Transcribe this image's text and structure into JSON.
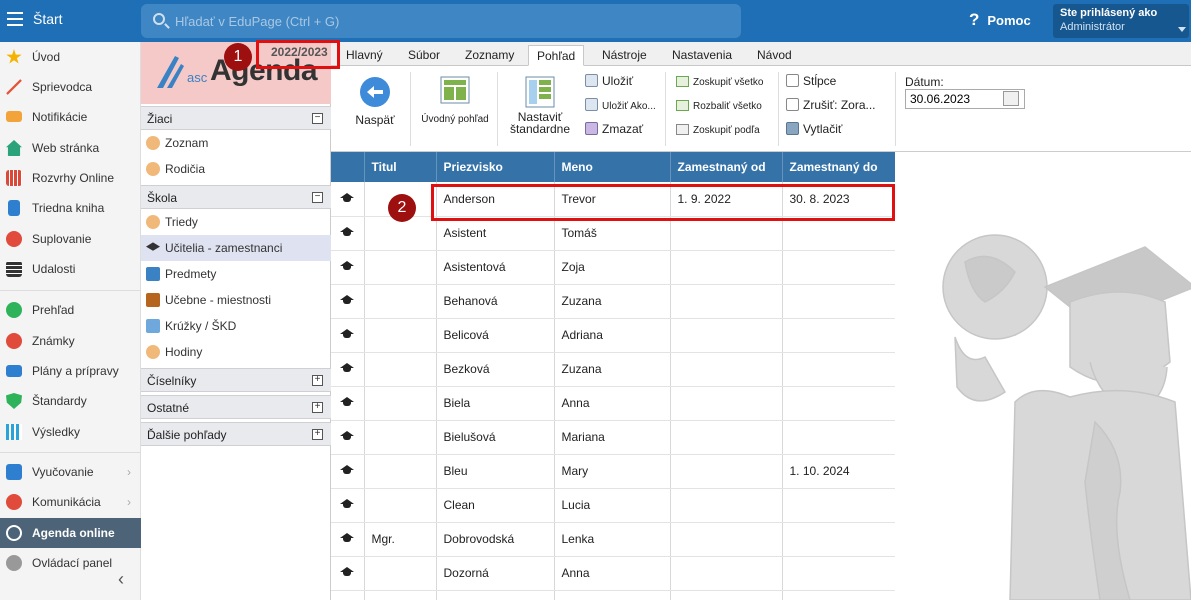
{
  "topbar": {
    "start_label": "Štart",
    "search_placeholder": "Hľadať v EduPage (Ctrl + G)",
    "help_label": "Pomoc",
    "user_line1": "Ste prihlásený ako",
    "user_line2": "Administrátor"
  },
  "leftnav": {
    "items": [
      {
        "label": "Úvod",
        "icon": "star-icon",
        "color": "#f5b301"
      },
      {
        "label": "Sprievodca",
        "icon": "wand-icon",
        "color": "#e2553b"
      },
      {
        "label": "Notifikácie",
        "icon": "envelope-icon",
        "color": "#f2a33a"
      },
      {
        "label": "Web stránka",
        "icon": "home-icon",
        "color": "#2aa37a"
      },
      {
        "label": "Rozvrhy Online",
        "icon": "grid-icon",
        "color": "#d94a3b"
      },
      {
        "label": "Triedna kniha",
        "icon": "book-icon",
        "color": "#2f7fd0"
      },
      {
        "label": "Suplovanie",
        "icon": "person-icon",
        "color": "#e04b3b"
      },
      {
        "label": "Udalosti",
        "icon": "calendar-icon",
        "color": "#333333"
      },
      {
        "label": "Prehľad",
        "icon": "check-icon",
        "color": "#2fb35a"
      },
      {
        "label": "Známky",
        "icon": "grade-icon",
        "color": "#e04b3b"
      },
      {
        "label": "Plány a prípravy",
        "icon": "briefcase-icon",
        "color": "#2f7fd0"
      },
      {
        "label": "Štandardy",
        "icon": "shield-icon",
        "color": "#2fb35a"
      },
      {
        "label": "Výsledky",
        "icon": "bar-chart-icon",
        "color": "#2aa3d9"
      },
      {
        "label": "Vyučovanie",
        "icon": "teaching-icon",
        "color": "#2f7fd0"
      },
      {
        "label": "Komunikácia",
        "icon": "chat-icon",
        "color": "#e04b3b"
      },
      {
        "label": "Agenda online",
        "icon": "agenda-icon",
        "color": "#ffffff"
      },
      {
        "label": "Ovládací panel",
        "icon": "gear-icon",
        "color": "#999999"
      }
    ]
  },
  "agenda": {
    "logo_prefix": "asc",
    "logo_text": "Agenda",
    "sections": {
      "ziaci": "Žiaci",
      "skola": "Škola",
      "ciselniky": "Číselníky",
      "ostatne": "Ostatné",
      "dalsie": "Ďalšie pohľady"
    },
    "ziaci_items": [
      "Zoznam",
      "Rodičia"
    ],
    "skola_items": [
      "Triedy",
      "Učitelia - zamestnanci",
      "Predmety",
      "Učebne - miestnosti",
      "Krúžky / ŠKD",
      "Hodiny"
    ],
    "expanded_symbol": "−",
    "collapsed_symbol": "+"
  },
  "ribbon": {
    "year": "2022/2023",
    "tabs": [
      "Hlavný",
      "Súbor",
      "Zoznamy",
      "Pohľad",
      "Nástroje",
      "Nastavenia",
      "Návod"
    ],
    "active_tab": "Pohľad",
    "back_label": "Naspäť",
    "intro_view_label": "Úvodný pohľad",
    "set_standard_label_1": "Nastaviť",
    "set_standard_label_2": "štandardne",
    "save_label": "Uložiť",
    "save_as_label": "Uložiť Ako...",
    "delete_label": "Zmazať",
    "group_all_label": "Zoskupiť všetko",
    "expand_all_label": "Rozbaliť všetko",
    "group_by_label": "Zoskupiť podľa",
    "columns_label": "Stĺpce",
    "cancel_sort_label": "Zrušiť: Zora...",
    "print_label": "Vytlačiť",
    "date_label": "Dátum:",
    "date_value": "30.06.2023"
  },
  "table": {
    "headers": [
      "",
      "Titul",
      "Priezvisko",
      "Meno",
      "Zamestnaný od",
      "Zamestnaný do"
    ],
    "rows": [
      {
        "titul": "",
        "priezvisko": "Anderson",
        "meno": "Trevor",
        "od": "1. 9. 2022",
        "do": "30. 8. 2023"
      },
      {
        "titul": "",
        "priezvisko": "Asistent",
        "meno": "Tomáš",
        "od": "",
        "do": ""
      },
      {
        "titul": "",
        "priezvisko": "Asistentová",
        "meno": "Zoja",
        "od": "",
        "do": ""
      },
      {
        "titul": "",
        "priezvisko": "Behanová",
        "meno": "Zuzana",
        "od": "",
        "do": ""
      },
      {
        "titul": "",
        "priezvisko": "Belicová",
        "meno": "Adriana",
        "od": "",
        "do": ""
      },
      {
        "titul": "",
        "priezvisko": "Bezková",
        "meno": "Zuzana",
        "od": "",
        "do": ""
      },
      {
        "titul": "",
        "priezvisko": "Biela",
        "meno": "Anna",
        "od": "",
        "do": ""
      },
      {
        "titul": "",
        "priezvisko": "Bielušová",
        "meno": "Mariana",
        "od": "",
        "do": ""
      },
      {
        "titul": "",
        "priezvisko": "Bleu",
        "meno": "Mary",
        "od": "",
        "do": "1. 10. 2024"
      },
      {
        "titul": "",
        "priezvisko": "Clean",
        "meno": "Lucia",
        "od": "",
        "do": ""
      },
      {
        "titul": "Mgr.",
        "priezvisko": "Dobrovodská",
        "meno": "Lenka",
        "od": "",
        "do": ""
      },
      {
        "titul": "",
        "priezvisko": "Dozorná",
        "meno": "Anna",
        "od": "",
        "do": ""
      },
      {
        "titul": "",
        "priezvisko": "",
        "meno": "",
        "od": "",
        "do": ""
      }
    ]
  },
  "annotations": {
    "badge1": "1",
    "badge2": "2",
    "highlight_color": "#e01010"
  },
  "colors": {
    "topbar": "#1e6fb5",
    "table_header": "#3472a8",
    "agenda_logo_bg": "#f6c9c9",
    "selected_item_bg": "#dfe3f1"
  }
}
